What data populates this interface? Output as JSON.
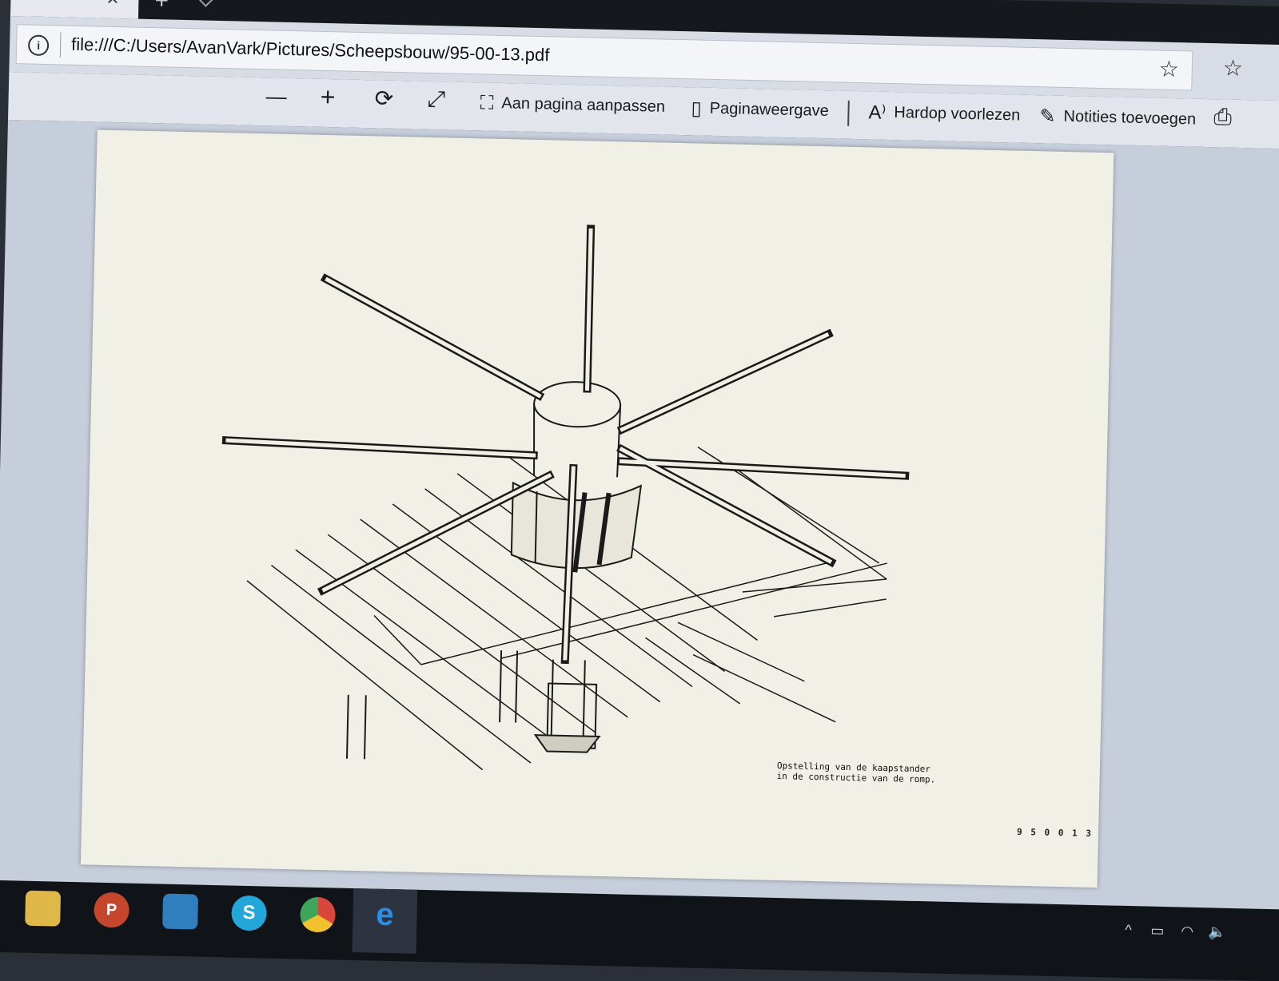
{
  "browser": {
    "tab_close_glyph": "×",
    "new_tab_glyph": "+",
    "address_url": "file:///C:/Users/AvanVark/Pictures/Scheepsbouw/95-00-13.pdf"
  },
  "toolbar": {
    "zoom_out_glyph": "—",
    "zoom_in_glyph": "+",
    "rotate_glyph": "⟳",
    "fullscreen_glyph": "⤢",
    "fit_page_label": "Aan pagina aanpassen",
    "page_view_label": "Paginaweergave",
    "read_aloud_label": "Hardop voorlezen",
    "read_aloud_icon_text": "A⁾",
    "add_notes_label": "Notities toevoegen",
    "print_glyph": "⎙"
  },
  "document": {
    "caption_line1": "Opstelling van de kaapstander",
    "caption_line2": "in de constructie van de romp.",
    "page_code": "9 5 0 0 1 3"
  },
  "taskbar": {
    "apps": [
      "file-explorer",
      "powerpoint",
      "mail",
      "skype",
      "chrome",
      "edge"
    ],
    "powerpoint_letter": "P",
    "skype_letter": "S",
    "edge_letter": "e"
  },
  "colors": {
    "page_background": "#f1f0e6",
    "viewer_background": "#c6cedb",
    "toolbar_background": "#e2e5eb",
    "taskbar_background": "#101318"
  }
}
